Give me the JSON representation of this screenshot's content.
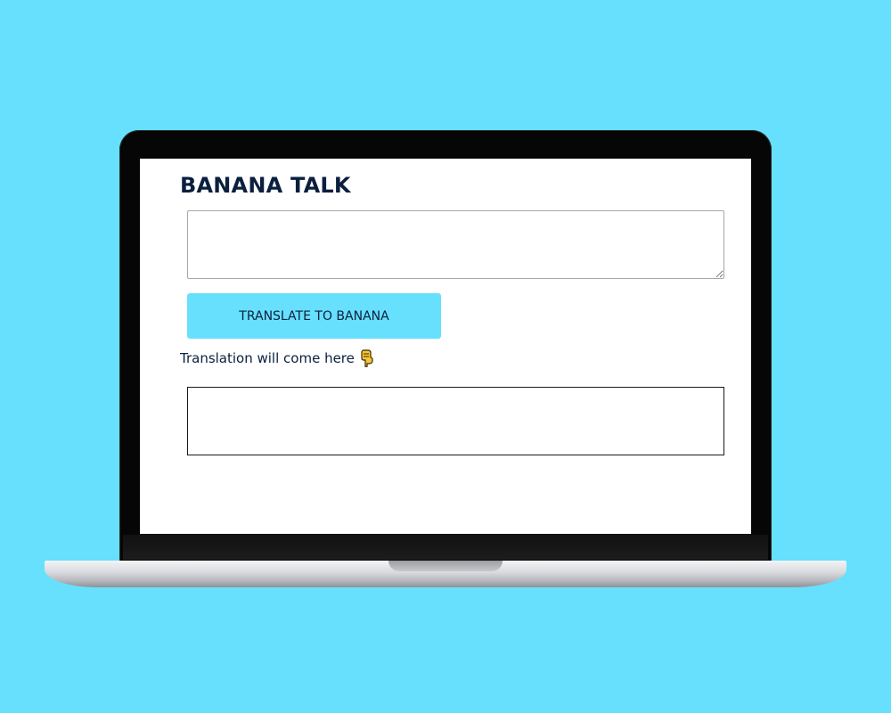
{
  "app": {
    "title": "BANANA TALK"
  },
  "input": {
    "value": "",
    "placeholder": ""
  },
  "translate_button": {
    "label": "TRANSLATE TO BANANA"
  },
  "hint": {
    "text": "Translation will come here",
    "icon": "backhand-index-pointing-down-icon"
  },
  "output": {
    "text": ""
  },
  "colors": {
    "background": "#66e0fd",
    "accent": "#66e0fd",
    "text": "#0b1f3f",
    "screen": "#ffffff"
  }
}
